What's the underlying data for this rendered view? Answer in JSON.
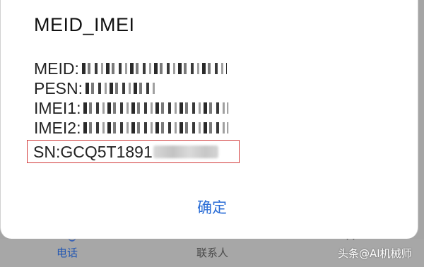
{
  "dialog": {
    "title": "MEID_IMEI",
    "rows": [
      {
        "label": "MEID:"
      },
      {
        "label": "PESN:"
      },
      {
        "label": "IMEI1:"
      },
      {
        "label": "IMEI2:"
      }
    ],
    "sn": {
      "label": "SN:GCQ5T1891"
    },
    "ok_label": "确定",
    "highlight_color": "#d23a3a",
    "accent_color": "#2b6dd6"
  },
  "bottom_nav": {
    "items": [
      {
        "label": "电话",
        "active": true
      },
      {
        "label": "联系人",
        "active": false
      }
    ]
  },
  "watermark": "头条@AI机械师"
}
